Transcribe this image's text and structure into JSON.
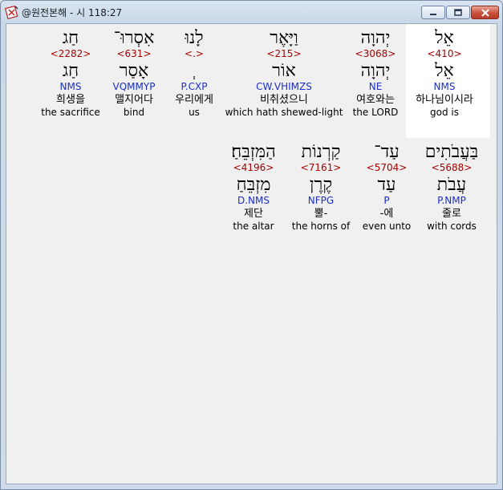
{
  "window": {
    "title": "@원전본해 - 시 118:27"
  },
  "words": [
    {
      "id": "w1",
      "hebrew": "אֵל",
      "strong": "<410>",
      "lemma": "אֵל",
      "grammar": "NMS",
      "korean": "하나님이시라",
      "english": "god is",
      "selected": true
    },
    {
      "id": "w2",
      "hebrew": "יְהוָה",
      "strong": "<3068>",
      "lemma": "יְהוָה",
      "grammar": "NE",
      "korean": "여호와는",
      "english": "the LORD",
      "selected": false
    },
    {
      "id": "w3",
      "hebrew": "וַיָּאֶר",
      "strong": "<215>",
      "lemma": "אוֹר",
      "grammar": "CW.VHIMZS",
      "korean": "비취셨으니",
      "english": "which hath shewed-light",
      "selected": false
    },
    {
      "id": "w4",
      "hebrew": "לָנוּ",
      "strong": "<.>",
      "lemma": "ְ",
      "grammar": "P.CXP",
      "korean": "우리에게",
      "english": "us",
      "selected": false
    },
    {
      "id": "w5",
      "hebrew": "אִסְרוּ־",
      "strong": "<631>",
      "lemma": "אָסַר",
      "grammar": "VQMMYP",
      "korean": "맬지어다",
      "english": "bind",
      "selected": false
    },
    {
      "id": "w6",
      "hebrew": "חַג",
      "strong": "<2282>",
      "lemma": "חַג",
      "grammar": "NMS",
      "korean": "희생을",
      "english": "the sacrifice",
      "selected": false
    },
    {
      "id": "w7",
      "hebrew": "בַּעֲבֹתִים",
      "strong": "<5688>",
      "lemma": "עֲבֹת",
      "grammar": "P.NMP",
      "korean": "줄로",
      "english": "with cords",
      "selected": false
    },
    {
      "id": "w8",
      "hebrew": "עַד־",
      "strong": "<5704>",
      "lemma": "עַד",
      "grammar": "P",
      "korean": "-에",
      "english": "even unto",
      "selected": false
    },
    {
      "id": "w9",
      "hebrew": "קַרְנוֹת",
      "strong": "<7161>",
      "lemma": "קֶרֶן",
      "grammar": "NFPG",
      "korean": "뿔-",
      "english": "the horns of",
      "selected": false
    },
    {
      "id": "w10",
      "hebrew": "הַמִּזְבֵּחַ׃",
      "strong": "<4196>",
      "lemma": "מִזְבֵּחַ",
      "grammar": "D.NMS",
      "korean": "제단",
      "english": "the altar",
      "selected": false
    }
  ],
  "icons": {
    "app": "bible-app-icon",
    "minimize": "minimize-icon",
    "maximize": "maximize-icon",
    "close": "close-icon"
  }
}
